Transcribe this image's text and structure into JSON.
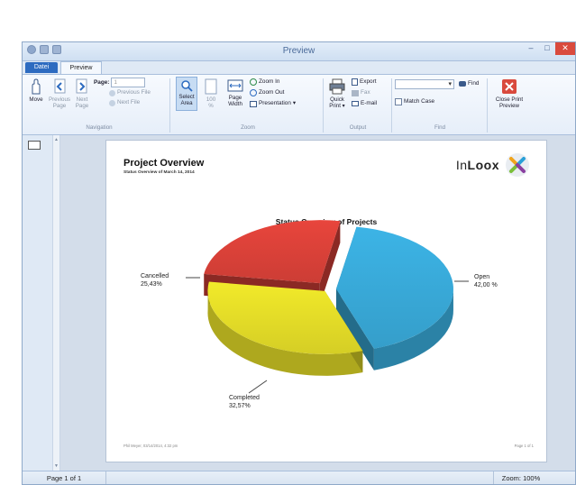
{
  "window": {
    "title": "Preview"
  },
  "tabs": {
    "file": "Datei",
    "preview": "Preview"
  },
  "navigation": {
    "move": "Move",
    "previous_page": [
      "Previous",
      "Page"
    ],
    "next_page": [
      "Next",
      "Page"
    ],
    "page_label": "Page:",
    "page_value": "1",
    "previous_file": "Previous File",
    "next_file": "Next File",
    "group": "Navigation"
  },
  "zoom": {
    "select_area": [
      "Select",
      "Area"
    ],
    "hundred": [
      "100",
      "%"
    ],
    "page_width": [
      "Page",
      "Width"
    ],
    "zoom_in": "Zoom In",
    "zoom_out": "Zoom Out",
    "presentation": "Presentation",
    "group": "Zoom"
  },
  "output": {
    "quick_print": [
      "Quick",
      "Print"
    ],
    "export": "Export",
    "fax": "Fax",
    "email": "E-mail",
    "group": "Output"
  },
  "find": {
    "find_label": "Find",
    "match_case": "Match Case",
    "group": "Find",
    "close_preview": [
      "Close Print",
      "Preview"
    ]
  },
  "document": {
    "title": "Project Overview",
    "subtitle": "Status Overview of March 14, 2014",
    "logo_light": "In",
    "logo_bold": "Loox",
    "footer_left": "Phil Meyer, 03/14/2014, 4:32 pm",
    "footer_right": "Page 1 of 1"
  },
  "chart_data": {
    "type": "pie",
    "title": "Status Overview of Projects",
    "slices": [
      {
        "label": "Open",
        "value": 42.0,
        "value_text": "42,00 %",
        "color": "#3cb4e6"
      },
      {
        "label": "Completed",
        "value": 32.57,
        "value_text": "32,57%",
        "color": "#f2ea2a"
      },
      {
        "label": "Cancelled",
        "value": 25.43,
        "value_text": "25,43%",
        "color": "#e8453c"
      }
    ]
  },
  "status": {
    "page": "Page 1 of 1",
    "zoom": "Zoom: 100%"
  },
  "colors": {
    "accent": "#2d6bc0",
    "close": "#d94a3d"
  }
}
